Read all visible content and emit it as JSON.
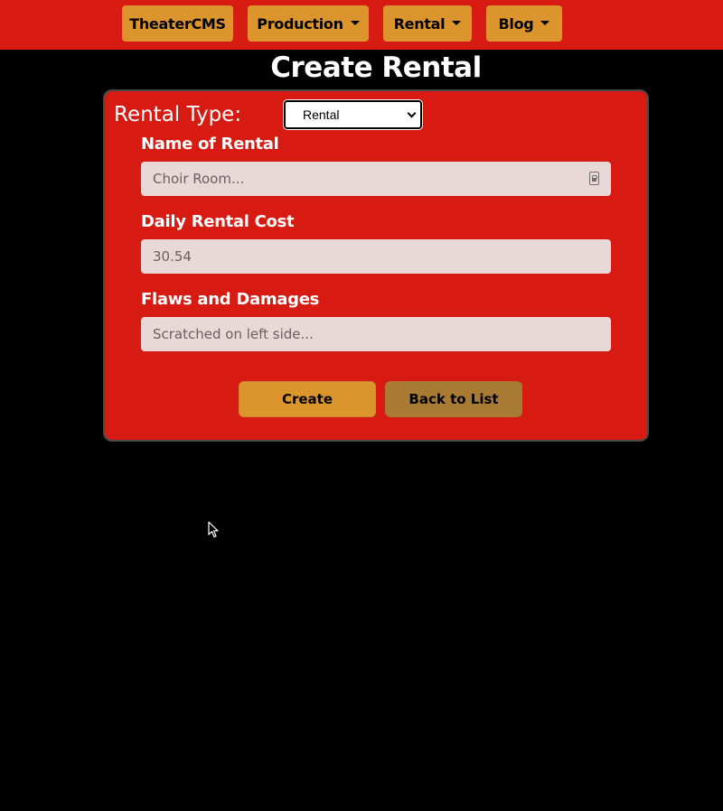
{
  "navbar": {
    "brand": "TheaterCMS",
    "production": "Production",
    "rental": "Rental",
    "blog": "Blog"
  },
  "page": {
    "title": "Create Rental"
  },
  "form": {
    "type_label": "Rental Type:",
    "type_value": "Rental",
    "name_label": "Name of Rental",
    "name_placeholder": "Choir Room...",
    "cost_label": "Daily Rental Cost",
    "cost_value": "30.54",
    "flaws_label": "Flaws and Damages",
    "flaws_placeholder": "Scratched on left side...",
    "create_label": "Create",
    "back_label": "Back to List"
  },
  "colors": {
    "navbar_bg": "#d71a12",
    "accent": "#dc952c",
    "back_button": "#a87a34",
    "background": "#000000"
  },
  "icons": [
    "caret-down-icon",
    "contact-card-icon",
    "select-chevron-icon",
    "mouse-cursor-icon"
  ]
}
